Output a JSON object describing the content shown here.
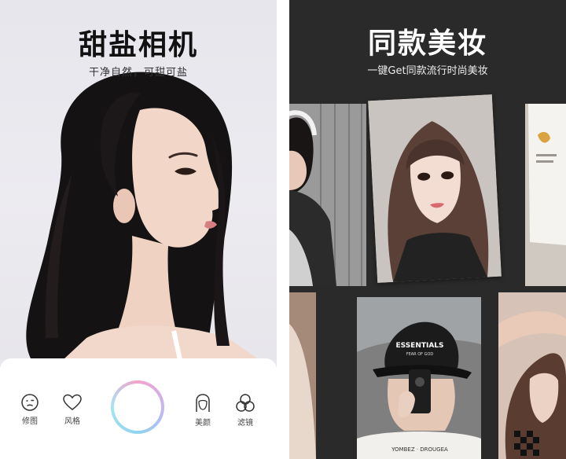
{
  "left_panel": {
    "title": "甜盐相机",
    "subtitle": "干净自然，可甜可盐",
    "toolbar": {
      "retouch_label": "修图",
      "style_label": "风格",
      "beauty_label": "美颜",
      "filter_label": "滤镜"
    }
  },
  "right_panel": {
    "title": "同款美妆",
    "subtitle": "一键Get同款流行时尚美妆",
    "cards": {
      "cap_text": "ESSENTIALS",
      "cap_subtext": "FEAR OF GOD",
      "shirt_text": "YOMBEZ · DROUGEA"
    }
  },
  "icons": {
    "retouch": "face-frown-icon",
    "style": "heart-icon",
    "beauty": "face-outline-icon",
    "filter": "three-circles-icon",
    "shutter": "shutter-button"
  },
  "colors": {
    "left_bg": "#e9e8ee",
    "right_bg": "#2a2a2a",
    "shutter_gradient": [
      "#f3a3c8",
      "#c7b4f2",
      "#8fd3ee"
    ]
  }
}
